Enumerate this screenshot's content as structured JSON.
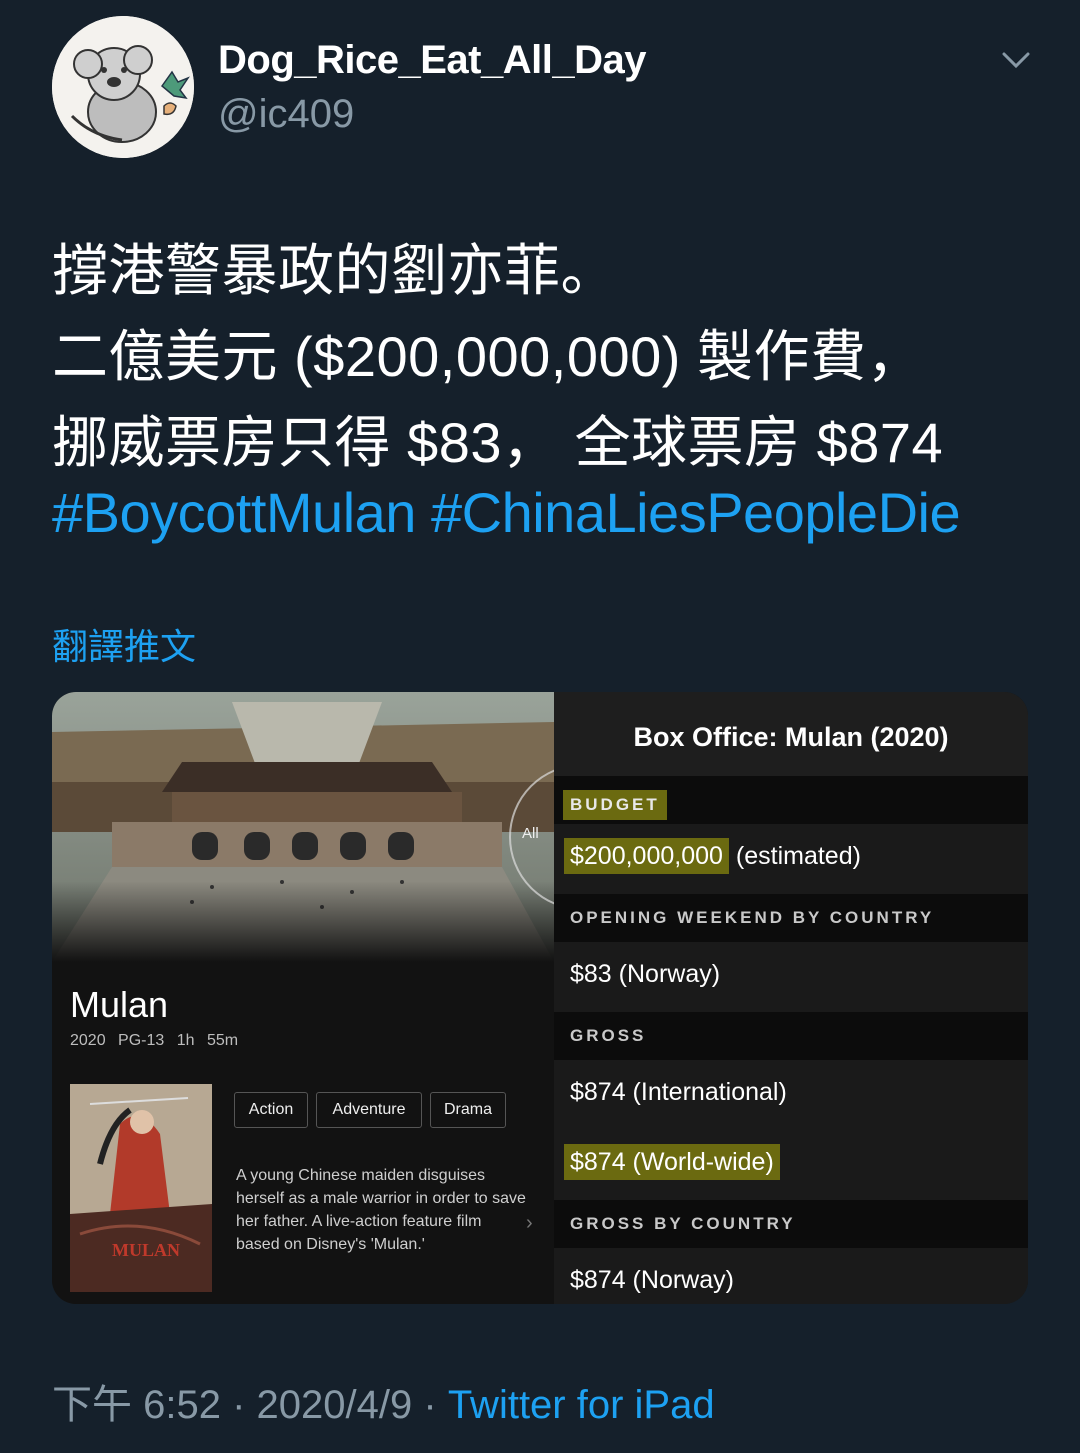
{
  "user": {
    "display_name": "Dog_Rice_Eat_All_Day",
    "handle": "@ic409"
  },
  "tweet": {
    "lines": [
      "撐港警暴政的劉亦菲。",
      "二億美元 ($200,000,000) 製作費，",
      "挪威票房只得 $83， 全球票房 $874"
    ],
    "hashtags": [
      "#BoycottMulan",
      "#ChinaLiesPeopleDie"
    ],
    "translate_label": "翻譯推文"
  },
  "card": {
    "scene_badge": "All",
    "movie_title": "Mulan",
    "meta": [
      "2020",
      "PG-13",
      "1h 55m"
    ],
    "genres": [
      "Action",
      "Adventure",
      "Drama"
    ],
    "plot": "A young Chinese maiden disguises herself as a male warrior in order to save her father. A live-action feature film based on Disney's 'Mulan.'",
    "poster_text": "MULAN",
    "box_office_title": "Box Office: Mulan (2020)",
    "sections": {
      "budget": "BUDGET",
      "budget_value": "$200,000,000",
      "budget_note": "(estimated)",
      "opening": "OPENING WEEKEND BY COUNTRY",
      "opening_value": "$83 (Norway)",
      "gross": "GROSS",
      "gross_intl": "$874 (International)",
      "gross_ww": "$874 (World-wide)",
      "gross_country": "GROSS BY COUNTRY",
      "gross_country_value": "$874 (Norway)"
    },
    "highlight_color": "#6b6a10"
  },
  "footer": {
    "time": "下午 6:52",
    "date": "2020/4/9",
    "separator": "·",
    "source": "Twitter for iPad"
  },
  "colors": {
    "background": "#15202b",
    "link": "#1da1f2",
    "secondary_text": "#8899a6"
  }
}
